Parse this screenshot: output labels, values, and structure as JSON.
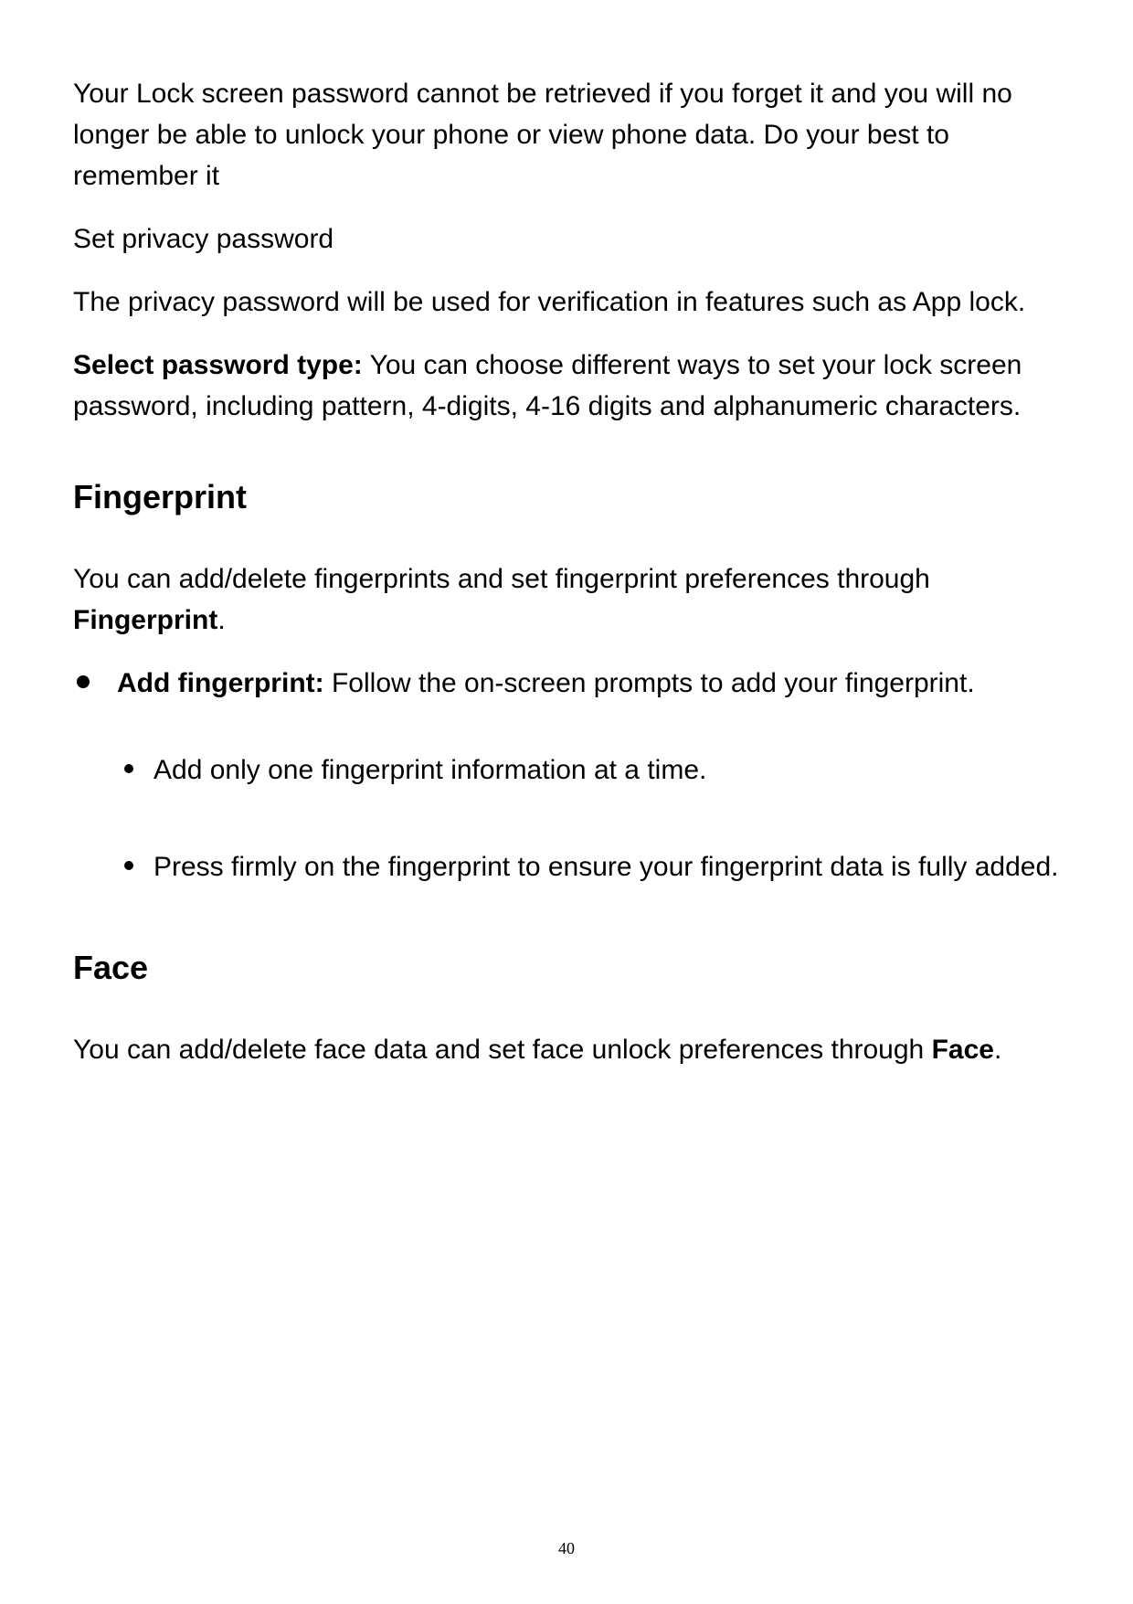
{
  "paragraphs": {
    "intro_warning": "Your Lock screen password cannot be retrieved if you forget it and you will no longer be able to unlock your phone or view phone data. Do your best to remember it",
    "set_privacy_password": "Set privacy password",
    "privacy_password_desc": "The privacy password will be used for verification in features such as App lock.",
    "select_password_type_label": "Select password type:",
    "select_password_type_desc": " You can choose different ways to set your lock screen password, including pattern, 4-digits, 4-16 digits and alphanumeric characters."
  },
  "sections": {
    "fingerprint": {
      "heading": "Fingerprint",
      "desc_part1": "You can add/delete fingerprints and set fingerprint preferences through ",
      "desc_bold": "Fingerprint",
      "desc_part2": ".",
      "bullet_label": "Add fingerprint:",
      "bullet_desc": " Follow the on-screen prompts to add your fingerprint.",
      "sub_bullets": [
        "Add only one fingerprint information at a time.",
        "Press firmly on the fingerprint to ensure your fingerprint data is fully added."
      ]
    },
    "face": {
      "heading": "Face",
      "desc_part1": "You can add/delete face data and set face unlock preferences through ",
      "desc_bold": "Face",
      "desc_part2": "."
    }
  },
  "page_number": "40"
}
